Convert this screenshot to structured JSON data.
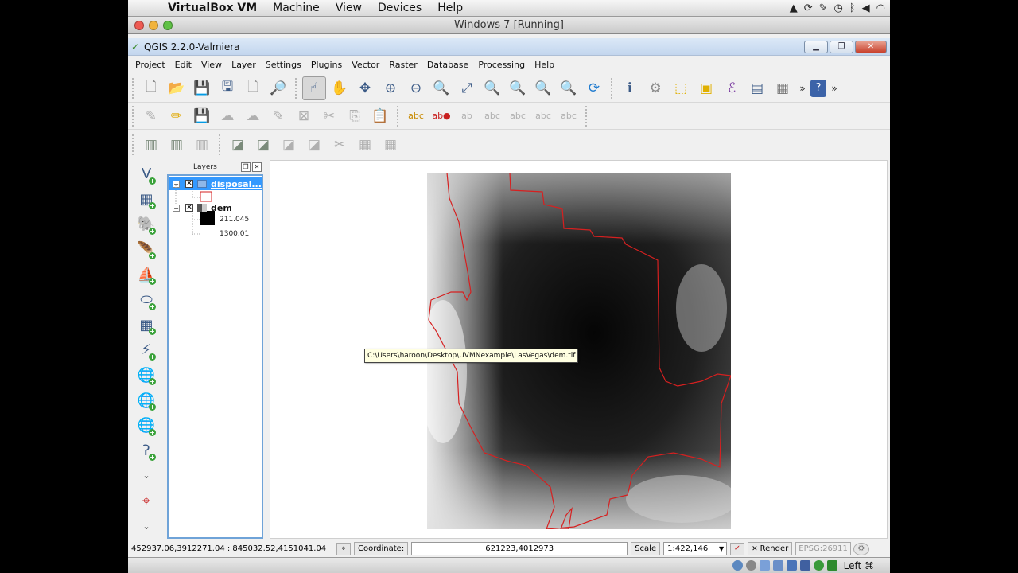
{
  "mac_menubar": {
    "app": "VirtualBox VM",
    "items": [
      "Machine",
      "View",
      "Devices",
      "Help"
    ]
  },
  "vbox": {
    "window_title": "Windows 7 [Running]"
  },
  "qgis": {
    "window_title": "QGIS 2.2.0-Valmiera",
    "menu": [
      "Project",
      "Edit",
      "View",
      "Layer",
      "Settings",
      "Plugins",
      "Vector",
      "Raster",
      "Database",
      "Processing",
      "Help"
    ]
  },
  "layers_panel": {
    "title": "Layers",
    "layers": [
      {
        "name": "disposal...",
        "checked": "✕",
        "selected": true
      },
      {
        "name": "dem",
        "checked": "✕",
        "selected": false
      }
    ],
    "dem_legend": {
      "max": "211.045",
      "min": "1300.01"
    }
  },
  "tooltip": {
    "text": "C:\\Users\\haroon\\Desktop\\UVMNexample\\LasVegas\\dem.tif"
  },
  "status": {
    "extent": "452937.06,3912271.04 : 845032.52,4151041.04",
    "coordinate_label": "Coordinate:",
    "coordinate_value": "621223,4012973",
    "scale_label": "Scale",
    "scale_value": "1:422,146",
    "render_label": "Render",
    "render_checked": "✕",
    "crs": "EPSG:26911"
  },
  "vbox_tray": {
    "host_key": "Left ⌘"
  },
  "colors": {
    "boundary": "#d62020",
    "selection": "#3399ff",
    "panel_border": "#6fa3d8"
  }
}
